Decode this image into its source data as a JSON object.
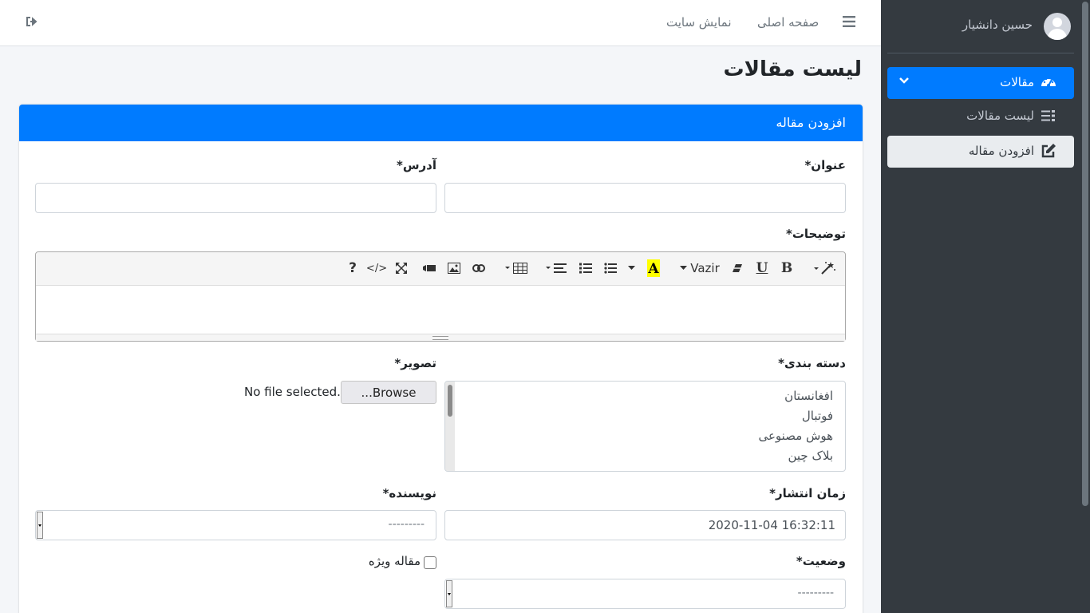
{
  "navbar": {
    "home_link": "صفحه اصلی",
    "site_link": "نمایش سایت"
  },
  "sidebar": {
    "user_name": "حسین دانشیار",
    "menu": {
      "main_label": "مقالات",
      "items": [
        {
          "label": "لیست مقالات"
        },
        {
          "label": "افزودن مقاله"
        }
      ]
    }
  },
  "page": {
    "title": "لیست مقالات"
  },
  "form": {
    "card_title": "افزودن مقاله",
    "title_label": "عنوان*",
    "address_label": "آدرس*",
    "title_value": "",
    "address_value": "",
    "description_label": "توضیحات*",
    "editor": {
      "font_name": "Vazir"
    },
    "category_label": "دسته بندی*",
    "categories": [
      "افغانستان",
      "فوتبال",
      "هوش مصنوعی",
      "بلاک چین"
    ],
    "image_label": "تصویر*",
    "browse_label": "Browse...",
    "no_file_text": "No file selected.",
    "publish_label": "زمان انتشار*",
    "publish_value": "2020-11-04 16:32:11",
    "author_label": "نویسنده*",
    "author_value": "---------",
    "status_label": "وضعیت*",
    "status_value": "---------",
    "featured_label": "مقاله ویژه",
    "featured_checked": false
  },
  "colors": {
    "primary": "#007bff",
    "sidebar_bg": "#343a40",
    "content_bg": "#f4f6f9"
  }
}
